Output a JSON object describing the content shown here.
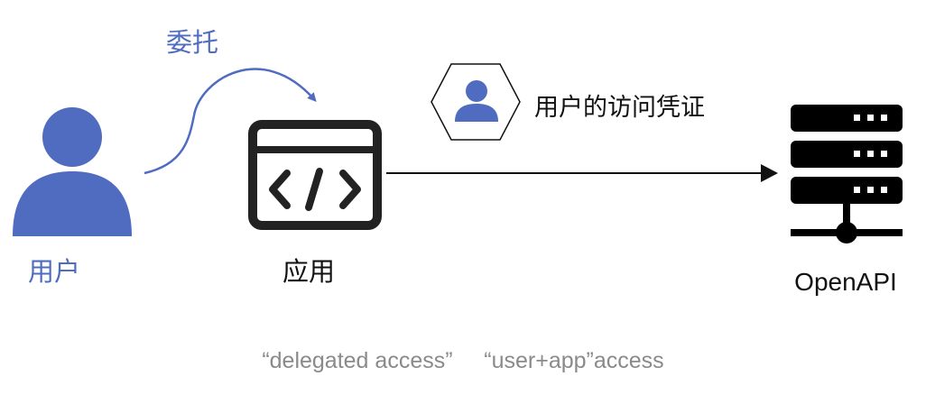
{
  "nodes": {
    "user": {
      "label": "用户",
      "icon": "person-icon"
    },
    "app": {
      "label": "应用",
      "icon": "code-window-icon"
    },
    "server": {
      "label": "OpenAPI",
      "icon": "server-rack-icon"
    }
  },
  "edges": {
    "delegation": {
      "label": "委托",
      "from": "user",
      "to": "app"
    },
    "access": {
      "label": "用户的访问凭证",
      "from": "app",
      "to": "server",
      "badge_icon": "user-hexagon-icon"
    }
  },
  "footer": {
    "caption": "“delegated access”     “user+app”access"
  },
  "colors": {
    "accent": "#4f6cc0",
    "dark": "#222222",
    "text": "#111111",
    "muted": "#8a8a8a"
  }
}
